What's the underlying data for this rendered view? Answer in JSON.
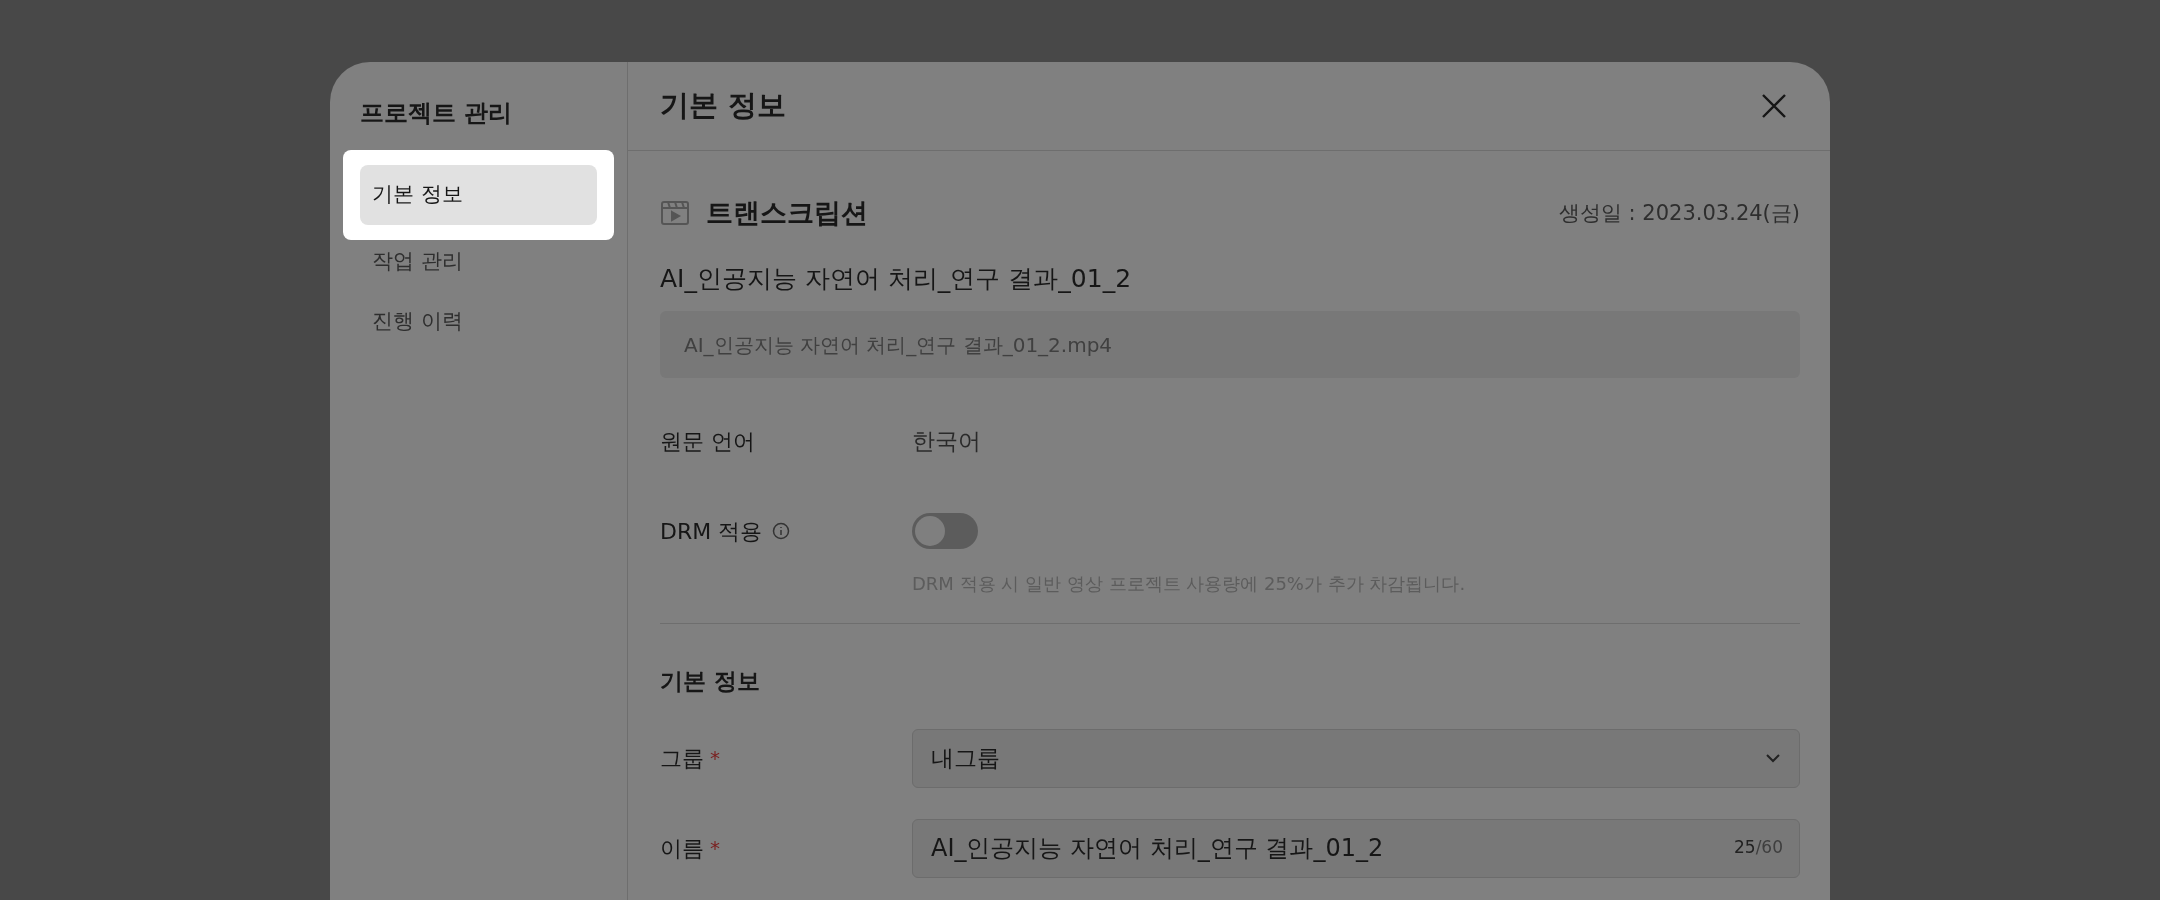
{
  "sidebar": {
    "title": "프로젝트 관리",
    "items": [
      {
        "label": "기본 정보",
        "selected": true
      },
      {
        "label": "작업 관리",
        "selected": false
      },
      {
        "label": "진행 이력",
        "selected": false
      }
    ]
  },
  "header": {
    "title": "기본 정보"
  },
  "project": {
    "type": "트랜스크립션",
    "created": "생성일 : 2023.03.24(금)",
    "name": "AI_인공지능 자연어 처리_연구 결과_01_2",
    "file": "AI_인공지능 자연어 처리_연구 결과_01_2.mp4"
  },
  "source_language": {
    "label": "원문 언어",
    "value": "한국어"
  },
  "drm": {
    "label": "DRM 적용",
    "on": false,
    "note": "DRM 적용 시 일반 영상 프로젝트 사용량에 25%가 추가 차감됩니다."
  },
  "section": {
    "title": "기본 정보",
    "fields": [
      {
        "kind": "select",
        "label": "그룹",
        "required_mark": "*",
        "value": "내그룹"
      },
      {
        "kind": "text",
        "label": "이름",
        "required_mark": "*",
        "value": "AI_인공지능 자연어 처리_연구 결과_01_2",
        "count": "25",
        "max": "/60"
      }
    ]
  }
}
